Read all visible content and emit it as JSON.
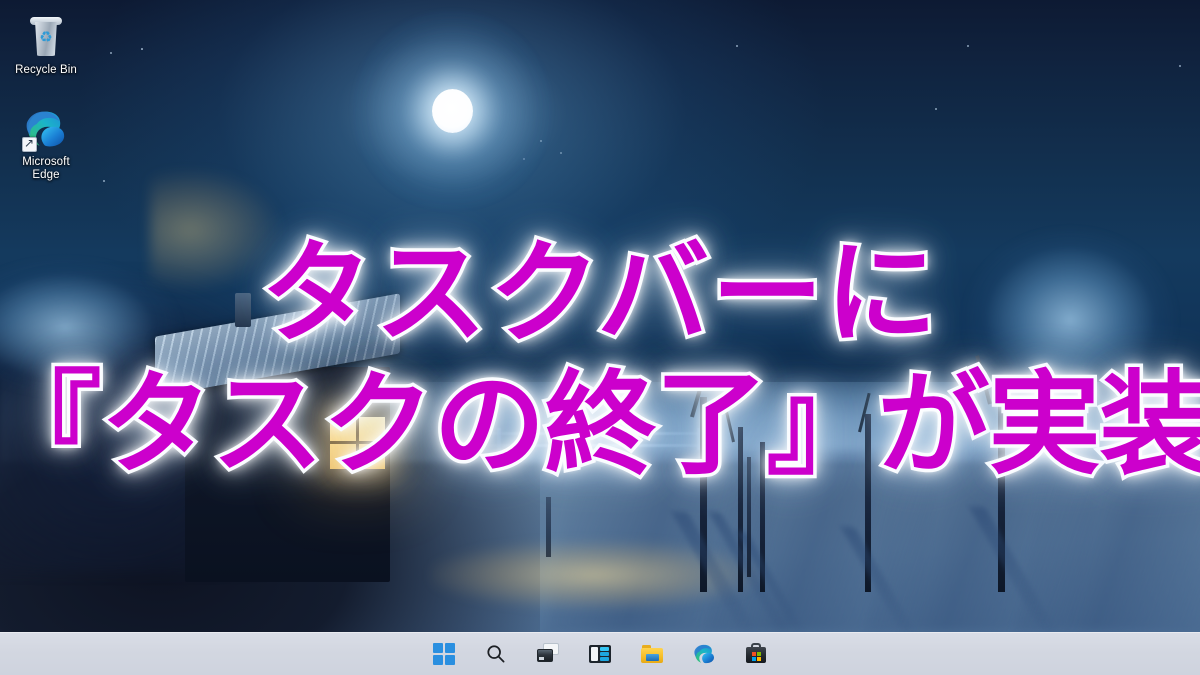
{
  "desktop": {
    "icons": [
      {
        "name": "recycle-bin",
        "label": "Recycle Bin",
        "icon": "recycle-bin-icon"
      },
      {
        "name": "microsoft-edge",
        "label": "Microsoft Edge",
        "label_line1": "Microsoft",
        "label_line2": "Edge",
        "icon": "edge-icon"
      }
    ],
    "wallpaper_description": "Winter night scene with full moon, snowy field, bare trees and a lit cabin window"
  },
  "headline": {
    "line1": "タスクバーに",
    "line2": "『タスクの終了』が実装",
    "fill_color": "#CC00CC",
    "stroke_color": "#FFFFFF",
    "glow_color": "#FFFFFF"
  },
  "taskbar": {
    "background_color": "#D4D8E2",
    "buttons": [
      {
        "name": "start-button",
        "label": "Start",
        "icon": "windows-logo-icon"
      },
      {
        "name": "search-button",
        "label": "Search",
        "icon": "search-icon"
      },
      {
        "name": "task-view-button",
        "label": "Task view",
        "icon": "task-view-icon"
      },
      {
        "name": "widgets-button",
        "label": "Widgets",
        "icon": "widgets-icon"
      },
      {
        "name": "file-explorer-button",
        "label": "File Explorer",
        "icon": "folder-icon"
      },
      {
        "name": "edge-button",
        "label": "Microsoft Edge",
        "icon": "edge-icon"
      },
      {
        "name": "store-button",
        "label": "Microsoft Store",
        "icon": "shopping-bag-icon"
      }
    ]
  },
  "colors": {
    "sky_top": "#0D1A33",
    "sky_mid": "#143A5E",
    "snow": "#96C3EB",
    "window_light": "#FFD981",
    "magenta": "#CC00CC"
  }
}
